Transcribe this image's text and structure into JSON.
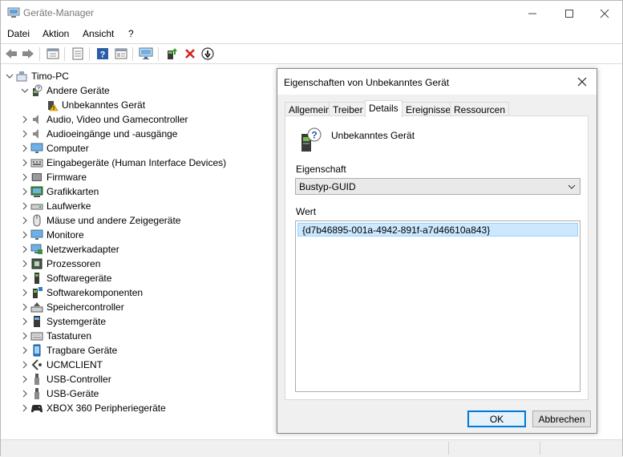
{
  "window": {
    "title": "Geräte-Manager"
  },
  "menu": [
    "Datei",
    "Aktion",
    "Ansicht",
    "?"
  ],
  "toolbar": {
    "buttons": [
      "back-icon",
      "forward-icon",
      "properties-sheet-icon",
      "view-icon",
      "help-icon",
      "view-list-icon",
      "monitor-scan-icon",
      "update-driver-icon",
      "uninstall-icon",
      "disable-device-icon"
    ]
  },
  "tree": {
    "root": "Timo-PC",
    "expanded_group": "Andere Geräte",
    "expanded_child": "Unbekanntes Gerät",
    "categories": [
      "Audio, Video und Gamecontroller",
      "Audioeingänge und -ausgänge",
      "Computer",
      "Eingabegeräte (Human Interface Devices)",
      "Firmware",
      "Grafikkarten",
      "Laufwerke",
      "Mäuse und andere Zeigegeräte",
      "Monitore",
      "Netzwerkadapter",
      "Prozessoren",
      "Softwaregeräte",
      "Softwarekomponenten",
      "Speichercontroller",
      "Systemgeräte",
      "Tastaturen",
      "Tragbare Geräte",
      "UCMCLIENT",
      "USB-Controller",
      "USB-Geräte",
      "XBOX 360 Peripheriegeräte"
    ]
  },
  "dialog": {
    "title": "Eigenschaften von Unbekanntes Gerät",
    "tabs": [
      "Allgemein",
      "Treiber",
      "Details",
      "Ereignisse",
      "Ressourcen"
    ],
    "active_tab": "Details",
    "device_name": "Unbekanntes Gerät",
    "property_label": "Eigenschaft",
    "property_value": "Bustyp-GUID",
    "value_label": "Wert",
    "value": "{d7b46895-001a-4942-891f-a7d46610a843}",
    "ok_label": "OK",
    "cancel_label": "Abbrechen"
  },
  "colors": {
    "accent": "#0078d7",
    "selection": "#cce8ff"
  }
}
